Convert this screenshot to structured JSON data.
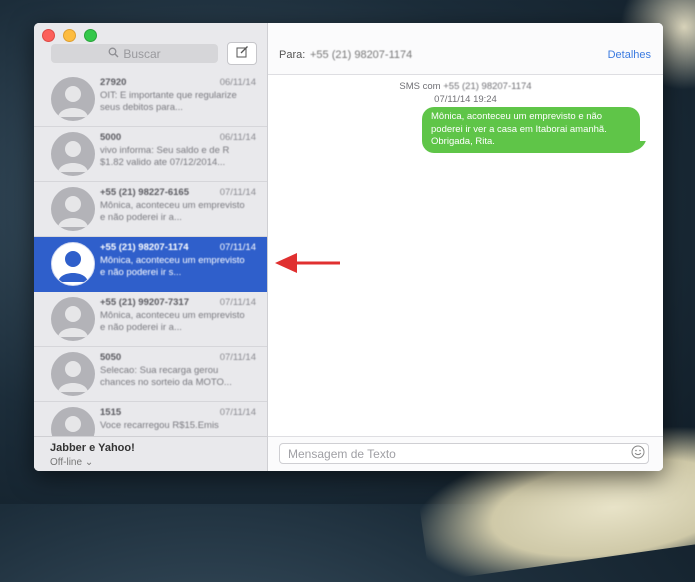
{
  "sidebar": {
    "search_placeholder": "Buscar",
    "compose_icon": "compose-icon",
    "conversations": [
      {
        "name": "27920",
        "date": "06/11/14",
        "preview": "OIT: E importante que regularize seus debitos para...",
        "selected": false
      },
      {
        "name": "5000",
        "date": "06/11/14",
        "preview": "vivo informa: Seu saldo e de R $1.82 valido ate 07/12/2014...",
        "selected": false
      },
      {
        "name": "+55 (21) 98227-6165",
        "date": "07/11/14",
        "preview": "Mônica, aconteceu um emprevisto e não poderei ir a...",
        "selected": false
      },
      {
        "name": "+55 (21) 98207-1174",
        "date": "07/11/14",
        "preview": "Mônica, aconteceu um emprevisto e não poderei ir s...",
        "selected": true
      },
      {
        "name": "+55 (21) 99207-7317",
        "date": "07/11/14",
        "preview": "Mônica, aconteceu um emprevisto e não poderei ir a...",
        "selected": false
      },
      {
        "name": "5050",
        "date": "07/11/14",
        "preview": "Selecao: Sua recarga gerou chances no sorteio da MOTO...",
        "selected": false
      },
      {
        "name": "1515",
        "date": "07/11/14",
        "preview": "Voce recarregou R$15.Emis",
        "selected": false
      }
    ],
    "account": {
      "name": "Jabber e Yahoo!",
      "status": "Off-line ⌄"
    }
  },
  "header": {
    "to_label": "Para:",
    "to_value": "+55 (21) 98207-1174",
    "details_label": "Detalhes"
  },
  "conversation": {
    "service_prefix": "SMS com",
    "service_number": "+55 (21) 98207-1174",
    "timestamp": "07/11/14 19:24",
    "message": "Mônica, aconteceu um emprevisto e não poderei ir ver a casa em Itaborai amanhã. Obrigada, Rita."
  },
  "composer": {
    "placeholder": "Mensagem de Texto",
    "emoji_icon": "emoji-icon"
  },
  "colors": {
    "selection": "#2f5fcb",
    "bubble": "#5fc548",
    "link": "#3c7be0",
    "arrow": "#e03030"
  }
}
